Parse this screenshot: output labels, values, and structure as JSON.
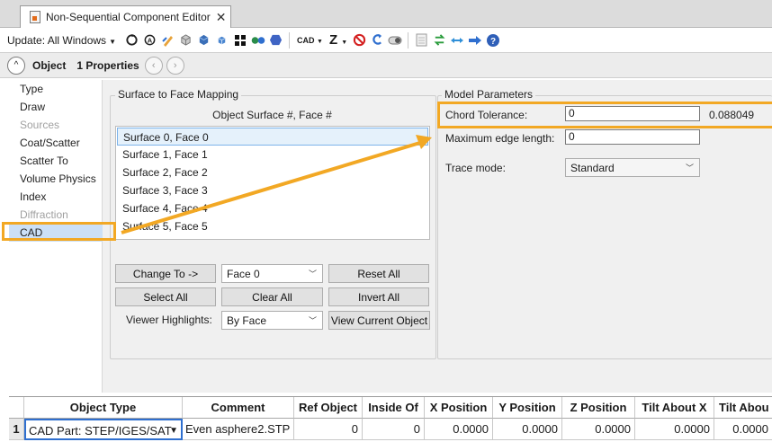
{
  "window": {
    "tab_title": "Non-Sequential Component Editor",
    "close_glyph": "✕"
  },
  "toolbar": {
    "update_label": "Update: All Windows",
    "cad_label": "CAD",
    "z_label": "Z",
    "icons": [
      "refresh-icon",
      "refresh-all-icon",
      "edit-icon",
      "shaded-solid-icon",
      "cube-blue-icon",
      "cube-small-icon",
      "grid-icon",
      "dots-icon",
      "hexagon-icon",
      "cad-menu-icon",
      "z-menu-icon",
      "no-entry-icon",
      "undo-icon",
      "toggle-icon",
      "page-icon",
      "swap-icon",
      "arrows-icon",
      "arrow-right-icon",
      "help-icon"
    ]
  },
  "object_header": {
    "label": "Object",
    "properties": "1 Properties",
    "prev_glyph": "‹",
    "next_glyph": "›",
    "collapse_glyph": "^"
  },
  "categories": [
    {
      "label": "Type",
      "disabled": false,
      "selected": false
    },
    {
      "label": "Draw",
      "disabled": false,
      "selected": false
    },
    {
      "label": "Sources",
      "disabled": true,
      "selected": false
    },
    {
      "label": "Coat/Scatter",
      "disabled": false,
      "selected": false
    },
    {
      "label": "Scatter To",
      "disabled": false,
      "selected": false
    },
    {
      "label": "Volume Physics",
      "disabled": false,
      "selected": false
    },
    {
      "label": "Index",
      "disabled": false,
      "selected": false
    },
    {
      "label": "Diffraction",
      "disabled": true,
      "selected": false
    },
    {
      "label": "CAD",
      "disabled": false,
      "selected": true
    }
  ],
  "mapping": {
    "group_title": "Surface to Face Mapping",
    "column_header": "Object Surface #, Face #",
    "items": [
      "Surface 0, Face 0",
      "Surface 1, Face 1",
      "Surface 2, Face 2",
      "Surface 3, Face 3",
      "Surface 4, Face 4",
      "Surface 5, Face 5"
    ],
    "change_to_label": "Change To ->",
    "face_combo_value": "Face 0",
    "reset_all_label": "Reset All",
    "select_all_label": "Select All",
    "clear_all_label": "Clear All",
    "invert_all_label": "Invert All",
    "viewer_highlights_label": "Viewer Highlights:",
    "viewer_highlights_value": "By Face",
    "view_current_label": "View Current Object"
  },
  "model_params": {
    "group_title": "Model Parameters",
    "chord_tolerance_label": "Chord Tolerance:",
    "chord_tolerance_value": "0",
    "chord_tolerance_computed": "0.088049",
    "max_edge_label": "Maximum edge length:",
    "max_edge_value": "0",
    "trace_mode_label": "Trace mode:",
    "trace_mode_value": "Standard"
  },
  "grid": {
    "headers": [
      "Object Type",
      "Comment",
      "Ref Object",
      "Inside Of",
      "X Position",
      "Y Position",
      "Z Position",
      "Tilt About X",
      "Tilt Abou"
    ],
    "row": {
      "num": "1",
      "object_type": "CAD Part: STEP/IGES/SAT",
      "comment": "Even asphere2.STP",
      "ref_object": "0",
      "inside_of": "0",
      "x_pos": "0.0000",
      "y_pos": "0.0000",
      "z_pos": "0.0000",
      "tilt_x": "0.0000",
      "tilt_y": "0.0000"
    }
  },
  "colors": {
    "highlight": "#f2a824",
    "selection": "#cce0f6",
    "accent_blue": "#2f6fcf"
  }
}
